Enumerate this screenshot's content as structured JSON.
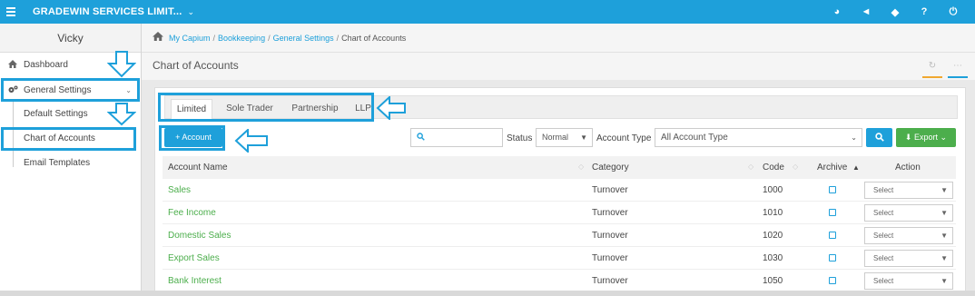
{
  "topbar": {
    "menu_icon": "hamburger-icon",
    "company": "GRADEWIN SERVICES LIMIT...",
    "company_caret": "⌄",
    "icons": [
      {
        "name": "palette-icon",
        "glyph": "◕"
      },
      {
        "name": "megaphone-icon",
        "glyph": "◄"
      },
      {
        "name": "tag-icon",
        "glyph": "◆"
      },
      {
        "name": "help-icon",
        "glyph": "?"
      },
      {
        "name": "power-icon",
        "glyph": "⏻"
      }
    ]
  },
  "sidebar": {
    "user": "Vicky",
    "items": [
      {
        "label": "Dashboard",
        "icon": "home-icon"
      },
      {
        "label": "General Settings",
        "icon": "cogs-icon"
      }
    ],
    "subitems": [
      {
        "label": "Default Settings"
      },
      {
        "label": "Chart of Accounts"
      },
      {
        "label": "Email Templates"
      }
    ]
  },
  "breadcrumb": {
    "items": [
      "My Capium",
      "Bookkeeping",
      "General Settings"
    ],
    "current": "Chart of Accounts"
  },
  "page": {
    "title": "Chart of Accounts"
  },
  "tabs": [
    {
      "label": "Limited",
      "active": true
    },
    {
      "label": "Sole Trader",
      "active": false
    },
    {
      "label": "Partnership",
      "active": false
    },
    {
      "label": "LLP",
      "active": false
    }
  ],
  "toolbar": {
    "add_account_label": "+ Account",
    "search_placeholder": "",
    "status_label": "Status",
    "status_value": "Normal",
    "account_type_label": "Account Type",
    "account_type_value": "All Account Type",
    "export_label": "Export"
  },
  "table": {
    "headers": {
      "account_name": "Account Name",
      "category": "Category",
      "code": "Code",
      "archive": "Archive",
      "action": "Action"
    },
    "rows": [
      {
        "name": "Sales",
        "category": "Turnover",
        "code": "1000",
        "action": "Select"
      },
      {
        "name": "Fee Income",
        "category": "Turnover",
        "code": "1010",
        "action": "Select"
      },
      {
        "name": "Domestic Sales",
        "category": "Turnover",
        "code": "1020",
        "action": "Select"
      },
      {
        "name": "Export Sales",
        "category": "Turnover",
        "code": "1030",
        "action": "Select"
      },
      {
        "name": "Bank Interest",
        "category": "Turnover",
        "code": "1050",
        "action": "Select"
      }
    ]
  },
  "colors": {
    "brand": "#1ea0da",
    "green": "#4cae4c",
    "highlight": "#1ea0da"
  }
}
